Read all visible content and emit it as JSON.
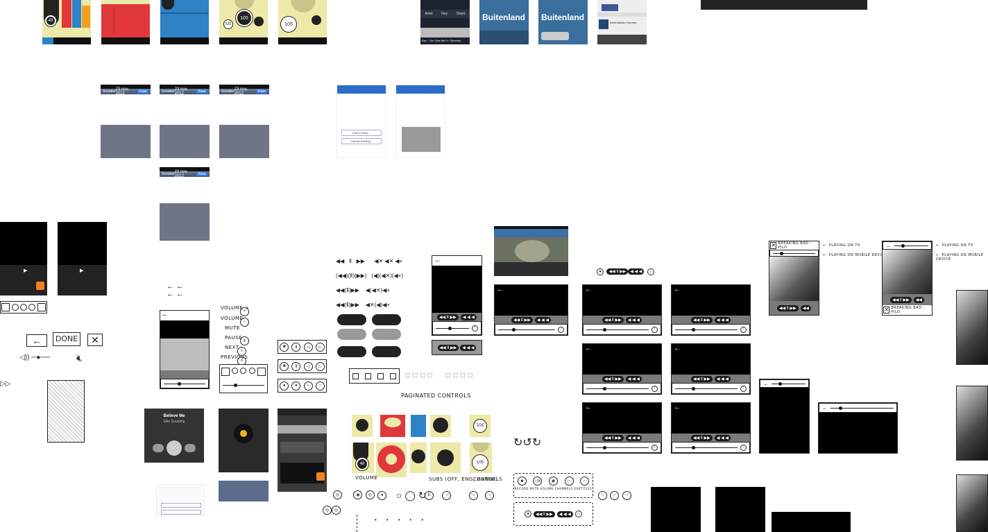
{
  "top_remote_cards": [
    {
      "dial_value": "48",
      "tabs": [
        "SETTINGS",
        "CHANNELS",
        "MUTE",
        "TEXT",
        "SOURCE"
      ]
    },
    {
      "tabs": [
        "SETTINGS",
        "CHANNELS",
        "MUTE",
        "TEXT",
        "SOURCE"
      ]
    },
    {
      "tabs": [
        "SETTINGS",
        "CHANNELS",
        "MUTE",
        "TEXT",
        "SOURCE"
      ]
    },
    {
      "dial_value": "105",
      "small_value": "535",
      "tabs": [
        "SETTINGS",
        "CHANNELS",
        "MUTE",
        "TEXT",
        "SOURCE"
      ]
    },
    {
      "dial_value": "105",
      "tabs": [
        "SETTINGS",
        "CHANNELS",
        "MUTE",
        "TEXT",
        "SOURCE"
      ]
    }
  ],
  "player_thumbs": [
    {
      "caption": "Rex - You Owe Me Fr. Ofeurotic",
      "tabs": [
        "Artist",
        "Ray",
        "Share"
      ]
    },
    {
      "title": "Buitenland"
    },
    {
      "title": "Buitenland"
    },
    {
      "caption": "Nederlandse Omroep"
    }
  ],
  "ios_date_screens": [
    {
      "left_btn": "Sneaker",
      "date": "23 nov. 2012",
      "right_btn": "Klaar",
      "keyboard_label": "spatie",
      "return": "retour"
    },
    {
      "left_btn": "Sneaker",
      "date": "23 nov. 2012",
      "right_btn": "Klaar",
      "keyboard_label": "spatie",
      "return": "retour"
    },
    {
      "left_btn": "Sneaker",
      "date": "23 nov. 2012",
      "right_btn": "Klaar",
      "keyboard_label": "spatie",
      "return": "retour"
    },
    {
      "left_btn": "Sneaker",
      "date": "23 nov. 2012",
      "right_btn": "Klaar",
      "keyboard_label": "spatie",
      "return": "retour"
    }
  ],
  "share_screens": [
    {
      "add_photo": "Foto's Photo...",
      "choose": "Choose Existing..."
    },
    {
      "add_photo": "",
      "choose": ""
    }
  ],
  "sketch_labels": {
    "done": "DONE",
    "volume_plus": "VOLUME +",
    "volume_minus": "VOLUME -",
    "mute": "MUTE",
    "pause": "PAUSE",
    "next": "NEXT",
    "previous": "PREVIOUS",
    "paginated_controls": "PAGINATED CONTROLS",
    "volume": "VOLUME",
    "subs": "SUBS (OFF, ENG, DUTCH)",
    "channels": "CHANNELS",
    "playing_on_tv": "PLAYING ON TV",
    "playing_on_mobile": "PLAYING ON MOBILE DEVICE",
    "show_title": "BREAKING BAD - PILO",
    "record": "RECORD",
    "mute_small": "MUTE",
    "volume_small": "VOLUME",
    "channels_small": "CHANNELS",
    "subtitles": "SUBTITLES"
  },
  "music_player": {
    "song": "Believe Me",
    "artist": "Ellie Goulding"
  },
  "volume_dial": {
    "value": "48"
  },
  "channels_dial": {
    "value": "105"
  },
  "colors": {
    "yellow": "#ede9a8",
    "red": "#e0383a",
    "blue": "#2e82c6",
    "orange": "#f0a020",
    "dark": "#111111",
    "control_grey": "#7a7a7a"
  }
}
